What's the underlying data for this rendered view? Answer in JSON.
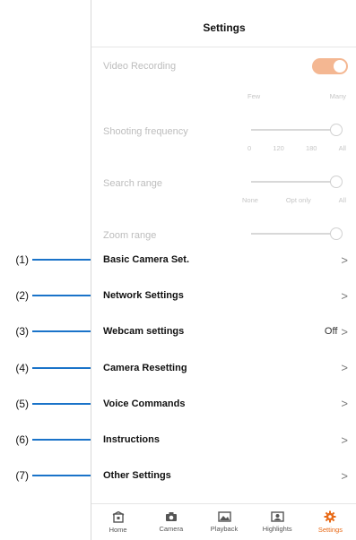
{
  "header": {
    "title": "Settings"
  },
  "video_recording": {
    "label": "Video Recording",
    "enabled": true
  },
  "shooting_frequency": {
    "label": "Shooting frequency",
    "ticks": [
      "Few",
      "Many"
    ],
    "level": 1.0
  },
  "search_range": {
    "label": "Search range",
    "ticks": [
      "0",
      "120",
      "180",
      "All"
    ],
    "level": 1.0
  },
  "zoom_range": {
    "label": "Zoom range",
    "ticks": [
      "None",
      "Opt only",
      "All"
    ],
    "level": 1.0
  },
  "menu": [
    {
      "callout": "(1)",
      "label": "Basic Camera Set.",
      "value": ""
    },
    {
      "callout": "(2)",
      "label": "Network Settings",
      "value": ""
    },
    {
      "callout": "(3)",
      "label": "Webcam settings",
      "value": "Off"
    },
    {
      "callout": "(4)",
      "label": "Camera Resetting",
      "value": ""
    },
    {
      "callout": "(5)",
      "label": "Voice Commands",
      "value": ""
    },
    {
      "callout": "(6)",
      "label": "Instructions",
      "value": ""
    },
    {
      "callout": "(7)",
      "label": "Other Settings",
      "value": ""
    }
  ],
  "tabs": [
    {
      "label": "Home",
      "icon": "home-icon",
      "active": false
    },
    {
      "label": "Camera",
      "icon": "camera-icon",
      "active": false
    },
    {
      "label": "Playback",
      "icon": "image-icon",
      "active": false
    },
    {
      "label": "Highlights",
      "icon": "highlights-icon",
      "active": false
    },
    {
      "label": "Settings",
      "icon": "gear-icon",
      "active": true
    }
  ],
  "colors": {
    "accent": "#e86a17",
    "callout_line": "#1a73c9",
    "toggle": "#f4b792"
  }
}
